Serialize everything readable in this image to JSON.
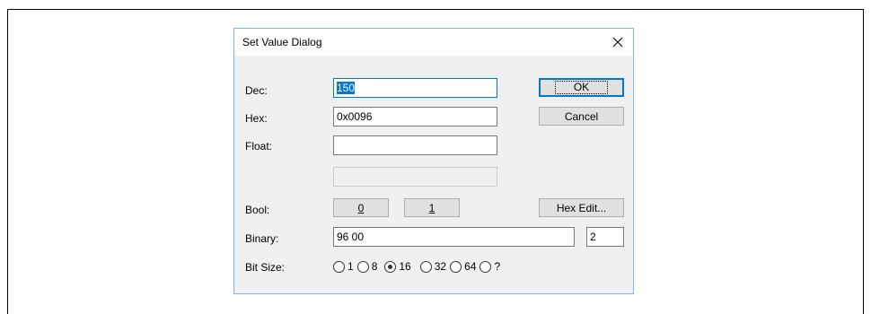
{
  "dialog": {
    "title": "Set Value Dialog"
  },
  "labels": {
    "dec": "Dec:",
    "hex": "Hex:",
    "float": "Float:",
    "bool": "Bool:",
    "binary": "Binary:",
    "bit_size": "Bit Size:"
  },
  "fields": {
    "dec_value": "150",
    "hex_value": "0x0096",
    "float_value": "",
    "float_extra_value": "",
    "binary_value": "96 00",
    "binary_count": "2"
  },
  "buttons": {
    "ok": "OK",
    "cancel": "Cancel",
    "bool_0": "0",
    "bool_1": "1",
    "hex_edit": "Hex Edit..."
  },
  "bit_size": {
    "options": [
      "1",
      "8",
      "16",
      "32",
      "64",
      "?"
    ],
    "selected": "16"
  },
  "colors": {
    "accent": "#0078d7",
    "dialog_bg": "#f0f0f0"
  }
}
